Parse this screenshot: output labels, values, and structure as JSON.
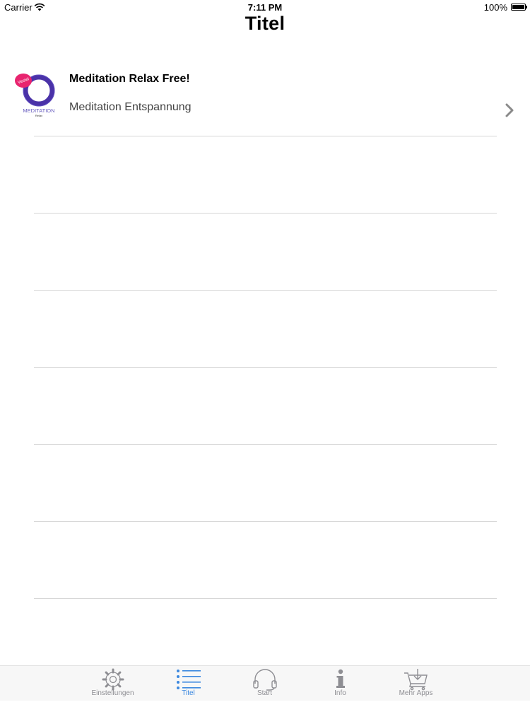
{
  "status_bar": {
    "carrier": "Carrier",
    "time": "7:11 PM",
    "battery": "100%"
  },
  "nav": {
    "title": "Titel"
  },
  "list": {
    "items": [
      {
        "title": "Meditation Relax Free!",
        "subtitle": "Meditation Entspannung",
        "icon_text": "MEDITATION",
        "icon_badge": "Vestel",
        "icon_subtext": "Relax"
      }
    ]
  },
  "tab_bar": {
    "active_color": "#3b88df",
    "inactive_color": "#8e8e93",
    "tabs": [
      {
        "label": "Einstellungen",
        "icon": "gear-icon"
      },
      {
        "label": "Titel",
        "icon": "list-icon",
        "active": true
      },
      {
        "label": "Start",
        "icon": "headphones-icon"
      },
      {
        "label": "Info",
        "icon": "info-icon"
      },
      {
        "label": "Mehr Apps",
        "icon": "cart-icon"
      }
    ]
  }
}
